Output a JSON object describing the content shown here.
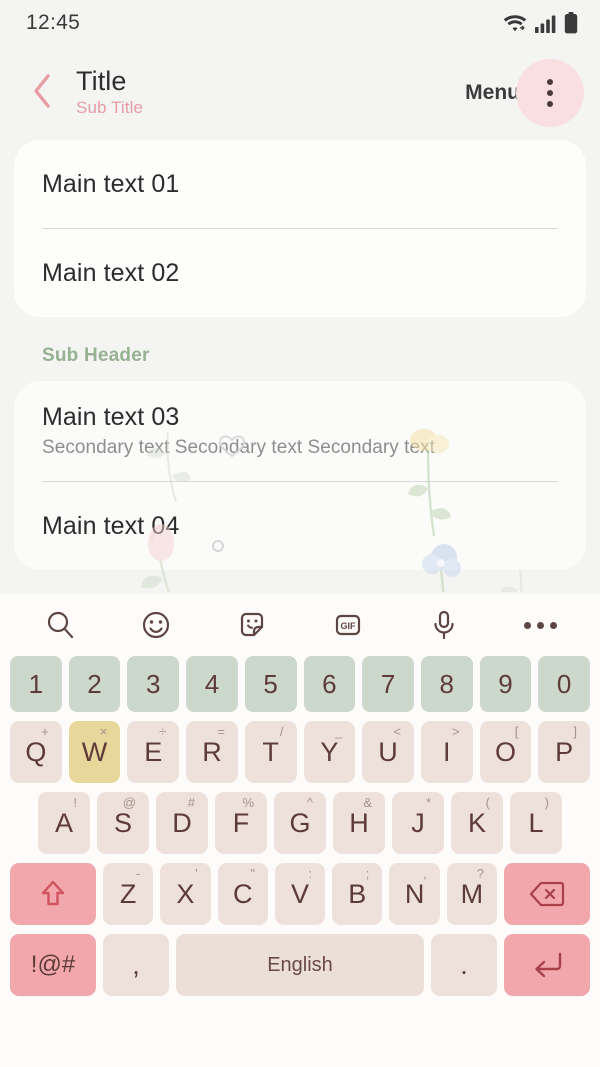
{
  "status_bar": {
    "time": "12:45",
    "icons": [
      "wifi-icon",
      "cellular-signal-icon",
      "battery-icon"
    ]
  },
  "app_bar": {
    "back_icon": "chevron-left-icon",
    "title": "Title",
    "subtitle": "Sub Title",
    "menu_label": "Menu",
    "overflow_icon": "more-vertical-icon",
    "accent_pink": "#e89ca5",
    "overflow_bg": "#f9dfe1"
  },
  "content": {
    "card_one": {
      "rows": [
        {
          "main": "Main text 01"
        },
        {
          "main": "Main text 02"
        }
      ]
    },
    "sub_header": "Sub Header",
    "sub_header_color": "#97b193",
    "card_two": {
      "rows": [
        {
          "main": "Main text 03",
          "secondary": "Secondary text Secondary text Secondary text"
        },
        {
          "main": "Main text 04"
        }
      ]
    }
  },
  "keyboard": {
    "toolbar": [
      {
        "name": "search-icon"
      },
      {
        "name": "emoji-icon"
      },
      {
        "name": "sticker-icon"
      },
      {
        "name": "gif-icon",
        "label": "GIF"
      },
      {
        "name": "microphone-icon"
      },
      {
        "name": "more-horizontal-icon"
      }
    ],
    "number_row": [
      "1",
      "2",
      "3",
      "4",
      "5",
      "6",
      "7",
      "8",
      "9",
      "0"
    ],
    "row_one": [
      {
        "key": "Q",
        "sup": "+"
      },
      {
        "key": "W",
        "sup": "×",
        "active": true
      },
      {
        "key": "E",
        "sup": "÷"
      },
      {
        "key": "R",
        "sup": "="
      },
      {
        "key": "T",
        "sup": "/"
      },
      {
        "key": "Y",
        "sup": "_"
      },
      {
        "key": "U",
        "sup": "<"
      },
      {
        "key": "I",
        "sup": ">"
      },
      {
        "key": "O",
        "sup": "["
      },
      {
        "key": "P",
        "sup": "]"
      }
    ],
    "row_two": [
      {
        "key": "A",
        "sup": "!"
      },
      {
        "key": "S",
        "sup": "@"
      },
      {
        "key": "D",
        "sup": "#"
      },
      {
        "key": "F",
        "sup": "%"
      },
      {
        "key": "G",
        "sup": "^"
      },
      {
        "key": "H",
        "sup": "&"
      },
      {
        "key": "J",
        "sup": "*"
      },
      {
        "key": "K",
        "sup": "("
      },
      {
        "key": "L",
        "sup": ")"
      }
    ],
    "row_three": [
      {
        "key": "Z",
        "sup": "-"
      },
      {
        "key": "X",
        "sup": "'"
      },
      {
        "key": "C",
        "sup": "\""
      },
      {
        "key": "V",
        "sup": ":"
      },
      {
        "key": "B",
        "sup": ";"
      },
      {
        "key": "N",
        "sup": ","
      },
      {
        "key": "M",
        "sup": "?"
      }
    ],
    "shift_icon": "shift-arrow-icon",
    "backspace_icon": "backspace-icon",
    "row_four": {
      "symbols_label": "!@#",
      "comma_label": ",",
      "space_label": "English",
      "period_label": ".",
      "enter_icon": "enter-arrow-icon"
    },
    "colors": {
      "key_bg": "#eee0da",
      "number_key_bg": "#ccd8cc",
      "accent_key_bg": "#f2a7ad",
      "active_key_bg": "#e8d79b",
      "space_bg": "#ecdfd7",
      "key_text": "#5d3b38"
    }
  }
}
